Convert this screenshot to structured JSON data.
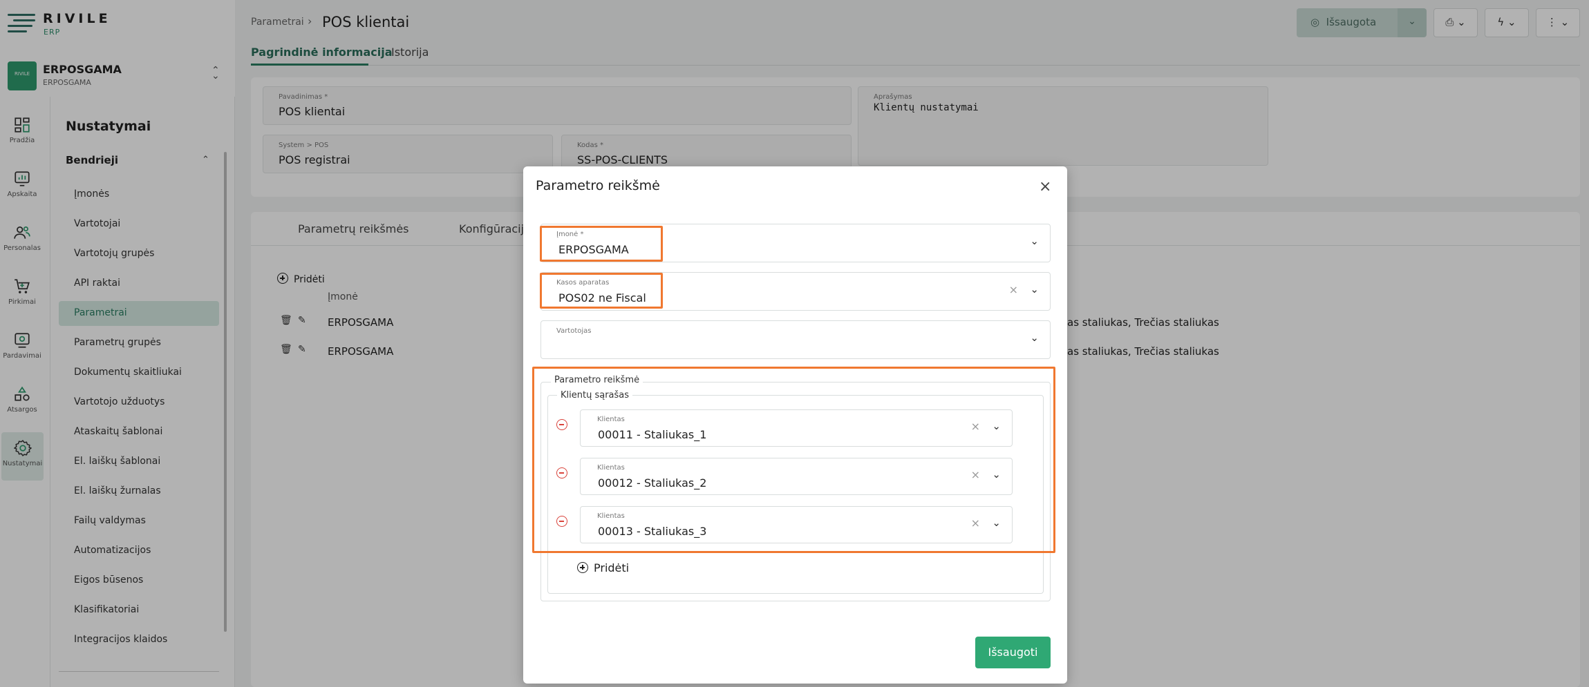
{
  "app": {
    "logo": "RIVILE",
    "logo_sub": "ERP"
  },
  "org": {
    "badge": "RIVILE",
    "name": "ERPOSGAMA",
    "sub": "ERPOSGAMA"
  },
  "rail": [
    {
      "label": "Pradžia",
      "icon": "dashboard-icon"
    },
    {
      "label": "Apskaita",
      "icon": "chart-icon"
    },
    {
      "label": "Personalas",
      "icon": "people-icon"
    },
    {
      "label": "Pirkimai",
      "icon": "cart-icon"
    },
    {
      "label": "Pardavimai",
      "icon": "sales-icon"
    },
    {
      "label": "Atsargos",
      "icon": "stock-icon"
    },
    {
      "label": "Nustatymai",
      "icon": "gear-icon"
    }
  ],
  "nav": {
    "title": "Nustatymai",
    "group": "Bendrieji",
    "items": [
      "Įmonės",
      "Vartotojai",
      "Vartotojų grupės",
      "API raktai",
      "Parametrai",
      "Parametrų grupės",
      "Dokumentų skaitliukai",
      "Vartotojo užduotys",
      "Ataskaitų šablonai",
      "El. laiškų šablonai",
      "El. laiškų žurnalas",
      "Failų valdymas",
      "Automatizacijos",
      "Eigos būsenos",
      "Klasifikatoriai",
      "Integracijos klaidos"
    ]
  },
  "header": {
    "breadcrumb": "Parametrai",
    "title": "POS klientai",
    "saved_label": "Išsaugota"
  },
  "tabs": [
    "Pagrindinė informacija",
    "Istorija"
  ],
  "form": {
    "name_label": "Pavadinimas *",
    "name_value": "POS klientai",
    "desc_label": "Aprašymas",
    "desc_value": "Klientų nustatymai",
    "system_label": "System > POS",
    "system_value": "POS registrai",
    "code_label": "Kodas *",
    "code_value": "SS-POS-CLIENTS"
  },
  "sub_tabs": [
    "Parametrų reikšmės",
    "Konfigūracija"
  ],
  "table": {
    "add_label": "Pridėti",
    "col_company": "Įmonė",
    "rows": [
      {
        "company": "ERPOSGAMA",
        "value_tail": "as staliukas, Trečias staliukas"
      },
      {
        "company": "ERPOSGAMA",
        "value_tail": "as staliukas, Trečias staliukas"
      }
    ]
  },
  "modal": {
    "title": "Parametro reikšmė",
    "company_label": "Įmonė *",
    "company_value": "ERPOSGAMA",
    "register_label": "Kasos aparatas",
    "register_value": "POS02 ne Fiscal",
    "user_label": "Vartotojas",
    "user_value": "",
    "fieldset_legend": "Parametro reikšmė",
    "list_legend": "Klientų sąrašas",
    "client_label": "Klientas",
    "clients": [
      "00011 - Staliukas_1",
      "00012 - Staliukas_2",
      "00013 - Staliukas_3"
    ],
    "add_label": "Pridėti",
    "save_label": "Išsaugoti"
  },
  "colors": {
    "accent": "#2fa874",
    "highlight": "#f07830",
    "remove": "#d9433b"
  }
}
